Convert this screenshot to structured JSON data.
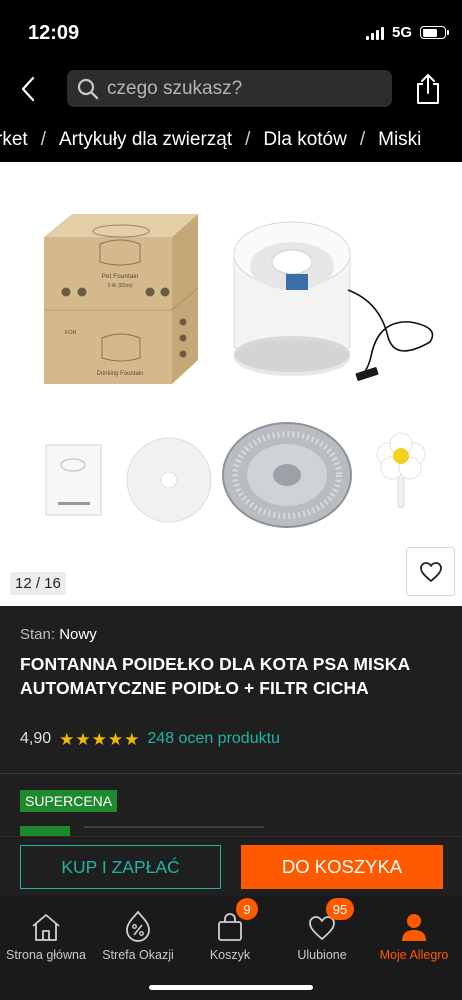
{
  "status_bar": {
    "time": "12:09",
    "network": "5G"
  },
  "header": {
    "search_placeholder": "czego szukasz?"
  },
  "breadcrumb": [
    "rket",
    "Artykuły dla zwierząt",
    "Dla kotów",
    "Miski"
  ],
  "breadcrumb_separator": "/",
  "gallery": {
    "counter": "12 / 16",
    "box_title": "Pet Fountain",
    "box_subtitle": "2.4L (82oz)",
    "box_side_label": "FOR",
    "box_bottom_label": "Drinking Fountain"
  },
  "product": {
    "condition_label": "Stan:",
    "condition_value": "Nowy",
    "title": "FONTANNA POIDEŁKO DLA KOTA PSA MISKA AUTOMATYCZNE POIDŁO + FILTR CICHA",
    "rating": "4,90",
    "stars": 5,
    "rating_count": "248 ocen produktu",
    "badge": "SUPERCENA"
  },
  "actions": {
    "buy_now": "KUP I ZAPŁAĆ",
    "add_to_cart": "DO KOSZYKA"
  },
  "nav": {
    "items": [
      {
        "label": "Strona główna",
        "icon": "home-icon"
      },
      {
        "label": "Strefa Okazji",
        "icon": "discount-icon"
      },
      {
        "label": "Koszyk",
        "icon": "cart-icon",
        "badge": "9"
      },
      {
        "label": "Ulubione",
        "icon": "heart-icon",
        "badge": "95"
      },
      {
        "label": "Moje Allegro",
        "icon": "user-icon"
      }
    ]
  },
  "colors": {
    "accent": "#ff5a00",
    "teal": "#1fb5a5",
    "star": "#f5b60a",
    "badge_green": "#1e8a2d"
  }
}
